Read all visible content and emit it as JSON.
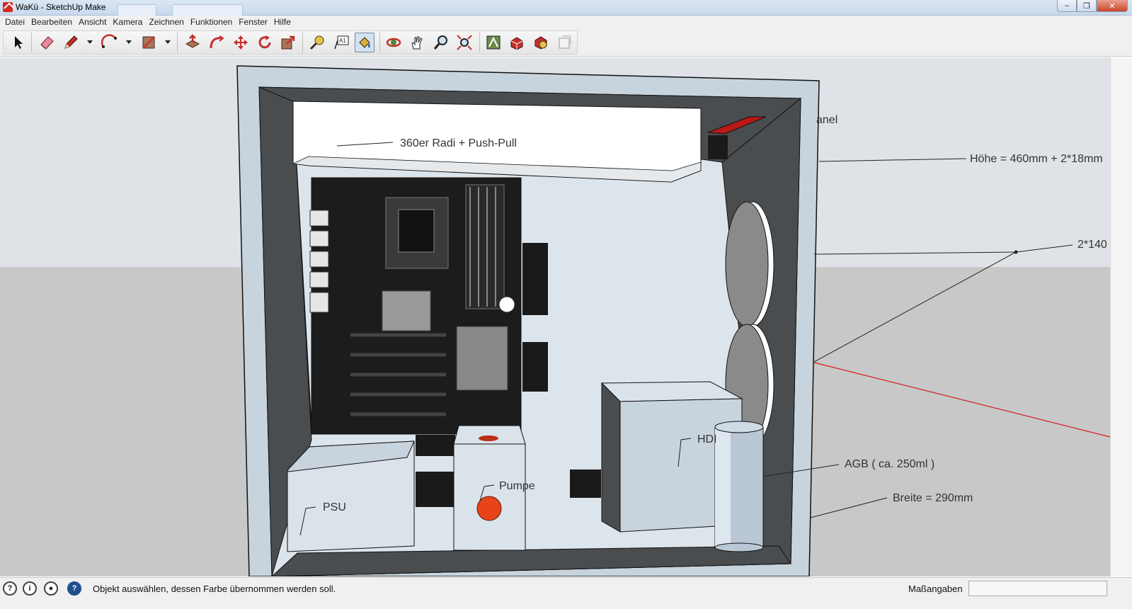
{
  "window": {
    "title": "WaKü - SketchUp Make",
    "controls": {
      "minimize": "–",
      "restore": "❐",
      "close": "✕"
    }
  },
  "menu": {
    "items": [
      "Datei",
      "Bearbeiten",
      "Ansicht",
      "Kamera",
      "Zeichnen",
      "Funktionen",
      "Fenster",
      "Hilfe"
    ]
  },
  "toolbar": {
    "tools": [
      "select-tool",
      "eraser-tool",
      "pencil-tool",
      "arc-tool",
      "rectangle-tool",
      "push-pull-tool",
      "follow-me-tool",
      "move-tool",
      "rotate-tool",
      "scale-tool",
      "tape-measure-tool",
      "text-tool",
      "paint-bucket-tool",
      "orbit-tool",
      "pan-tool",
      "zoom-tool",
      "zoom-extents-tool",
      "3d-warehouse-tool",
      "share-model-tool",
      "extension-warehouse-tool",
      "layout-tool"
    ],
    "active_tool": "paint-bucket-tool"
  },
  "viewport": {
    "labels": {
      "radiator": "360er Radi + Push-Pull",
      "panel": "anel",
      "height": "Höhe = 460mm + 2*18mm",
      "fans": "2*140",
      "hdd": "HDI",
      "reservoir": "AGB ( ca. 250ml )",
      "pump": "Pumpe",
      "psu": "PSU",
      "width": "Breite = 290mm"
    },
    "colors": {
      "sky": "#dfe3e7",
      "ground": "#c8c8c8",
      "case_front": "#c8d4dd",
      "case_inner": "#4a4d50",
      "pump_port": "#e8441a",
      "accent_red": "#b81818"
    }
  },
  "statusbar": {
    "message": "Objekt auswählen, dessen Farbe übernommen werden soll.",
    "measurements_label": "Maßangaben",
    "measurements_value": ""
  }
}
